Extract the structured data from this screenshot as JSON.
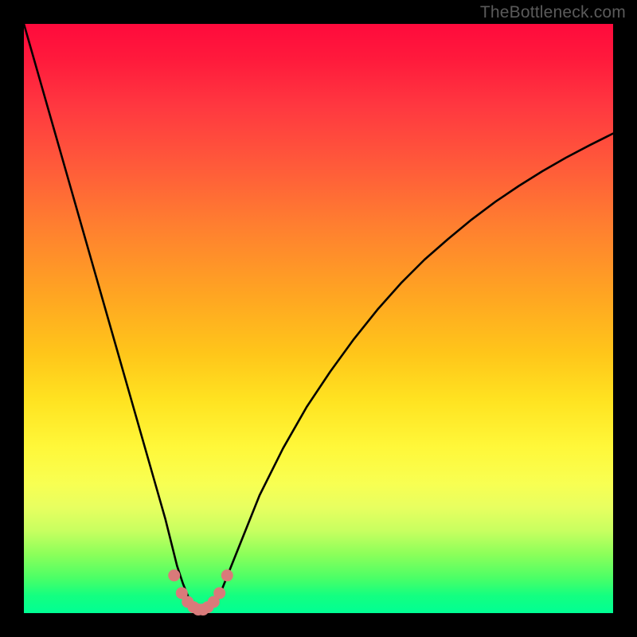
{
  "watermark": "TheBottleneck.com",
  "colors": {
    "frame": "#000000",
    "curve_stroke": "#000000",
    "marker_stroke": "#d97a7a",
    "marker_fill": "#d97a7a"
  },
  "chart_data": {
    "type": "line",
    "title": "",
    "xlabel": "",
    "ylabel": "",
    "xlim": [
      0,
      100
    ],
    "ylim": [
      0,
      100
    ],
    "grid": false,
    "legend": false,
    "series": [
      {
        "name": "bottleneck-curve",
        "x": [
          0,
          2,
          4,
          6,
          8,
          10,
          12,
          14,
          16,
          18,
          20,
          22,
          24,
          25,
          26,
          27,
          28,
          29,
          30,
          31,
          32,
          33,
          34,
          36,
          38,
          40,
          44,
          48,
          52,
          56,
          60,
          64,
          68,
          72,
          76,
          80,
          84,
          88,
          92,
          96,
          100
        ],
        "y": [
          100,
          93,
          86,
          79,
          72,
          65,
          58,
          51,
          44,
          37,
          30,
          23,
          16,
          12,
          8,
          5,
          2.5,
          1.2,
          0.5,
          0.5,
          1.2,
          2.5,
          5,
          10,
          15,
          20,
          28,
          35,
          41,
          46.5,
          51.5,
          56,
          60,
          63.5,
          66.8,
          69.8,
          72.5,
          75,
          77.3,
          79.4,
          81.4
        ]
      }
    ],
    "markers": {
      "name": "highlight-markers",
      "x": [
        25.5,
        26.8,
        27.8,
        28.8,
        29.6,
        30.4,
        31.2,
        32.2,
        33.2,
        34.5
      ],
      "y": [
        6.4,
        3.4,
        1.9,
        1.0,
        0.6,
        0.6,
        1.0,
        1.9,
        3.4,
        6.4
      ]
    }
  }
}
